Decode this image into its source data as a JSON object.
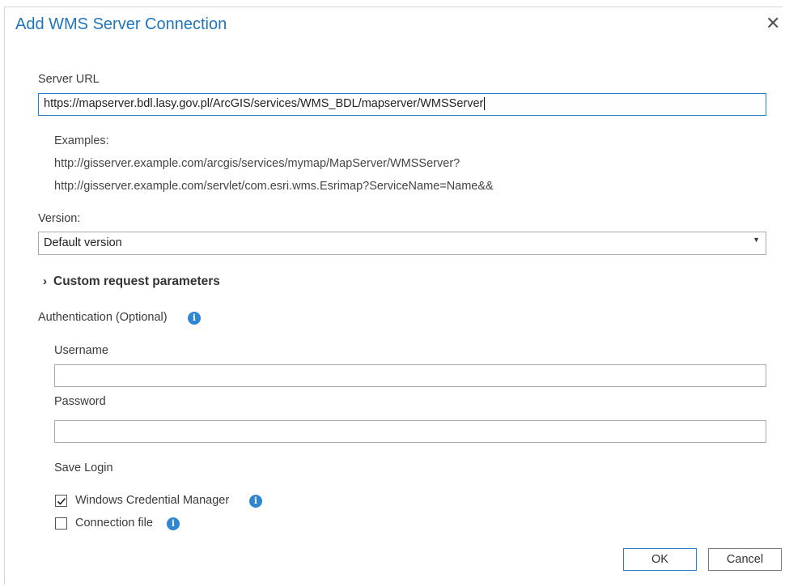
{
  "dialog": {
    "title": "Add WMS Server Connection",
    "close_glyph": "✕"
  },
  "server_url": {
    "label": "Server URL",
    "value": "https://mapserver.bdl.lasy.gov.pl/ArcGIS/services/WMS_BDL/mapserver/WMSServer"
  },
  "examples": {
    "heading": "Examples:",
    "items": [
      "http://gisserver.example.com/arcgis/services/mymap/MapServer/WMSServer?",
      "http://gisserver.example.com/servlet/com.esri.wms.Esrimap?ServiceName=Name&&"
    ]
  },
  "version": {
    "label": "Version:",
    "selected": "Default version",
    "arrow_glyph": "▼"
  },
  "custom_params": {
    "label": "Custom request parameters",
    "chevron_glyph": "›"
  },
  "auth": {
    "label": "Authentication (Optional)",
    "info_glyph": "i",
    "username_label": "Username",
    "username_value": "",
    "password_label": "Password",
    "password_value": "",
    "save_login_label": "Save Login",
    "options": [
      {
        "label": "Windows Credential Manager",
        "checked": true
      },
      {
        "label": "Connection file",
        "checked": false
      }
    ]
  },
  "buttons": {
    "ok": "OK",
    "cancel": "Cancel"
  },
  "colors": {
    "title": "#2474b8",
    "accent": "#2d7ec4",
    "info": "#2f86d1"
  }
}
